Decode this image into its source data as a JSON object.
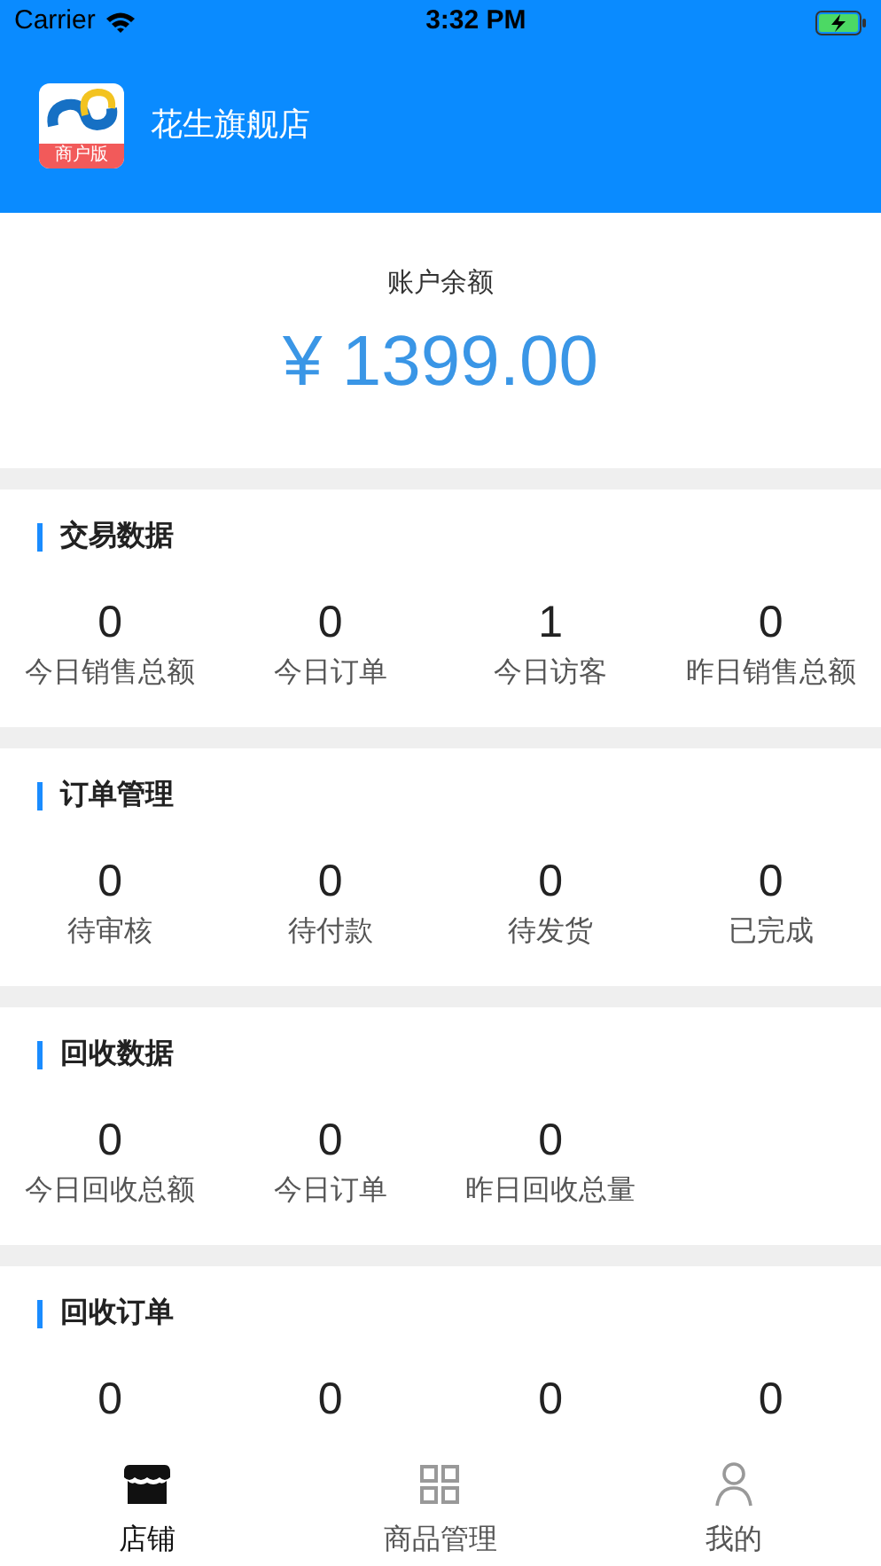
{
  "status_bar": {
    "carrier": "Carrier",
    "time": "3:32 PM"
  },
  "header": {
    "logo_badge": "商户版",
    "store_name": "花生旗舰店"
  },
  "balance": {
    "label": "账户余额",
    "amount": "¥ 1399.00"
  },
  "sections": [
    {
      "title": "交易数据",
      "stats": [
        {
          "value": "0",
          "label": "今日销售总额"
        },
        {
          "value": "0",
          "label": "今日订单"
        },
        {
          "value": "1",
          "label": "今日访客"
        },
        {
          "value": "0",
          "label": "昨日销售总额"
        }
      ]
    },
    {
      "title": "订单管理",
      "stats": [
        {
          "value": "0",
          "label": "待审核"
        },
        {
          "value": "0",
          "label": "待付款"
        },
        {
          "value": "0",
          "label": "待发货"
        },
        {
          "value": "0",
          "label": "已完成"
        }
      ]
    },
    {
      "title": "回收数据",
      "stats": [
        {
          "value": "0",
          "label": "今日回收总额"
        },
        {
          "value": "0",
          "label": "今日订单"
        },
        {
          "value": "0",
          "label": "昨日回收总量"
        }
      ]
    },
    {
      "title": "回收订单",
      "stats": [
        {
          "value": "0"
        },
        {
          "value": "0"
        },
        {
          "value": "0"
        },
        {
          "value": "0"
        }
      ]
    }
  ],
  "tabs": [
    {
      "label": "店铺",
      "selected": true,
      "kind": "store"
    },
    {
      "label": "商品管理",
      "selected": false,
      "kind": "grid"
    },
    {
      "label": "我的",
      "selected": false,
      "kind": "person"
    }
  ]
}
